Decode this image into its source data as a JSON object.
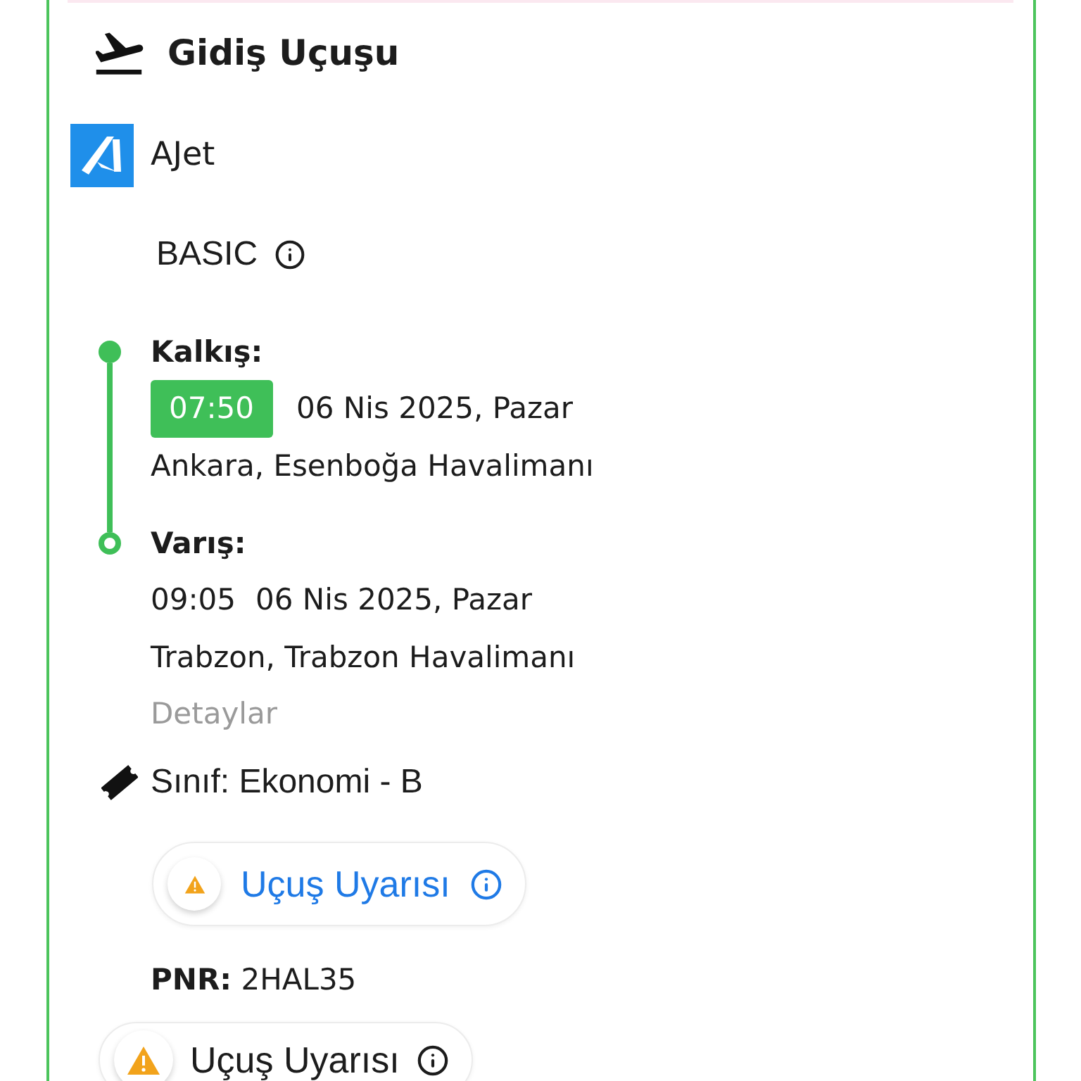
{
  "section": {
    "title": "Gidiş Uçuşu"
  },
  "airline": {
    "name": "AJet"
  },
  "fare": {
    "name": "BASIC"
  },
  "itinerary": [
    {
      "kind": "departure",
      "label": "Kalkış:",
      "time": "07:50",
      "highlighted": true,
      "date": "06 Nis 2025, Pazar",
      "airport": "Ankara, Esenboğa Havalimanı"
    },
    {
      "kind": "arrival",
      "label": "Varış:",
      "time": "09:05",
      "highlighted": false,
      "date": "06 Nis 2025, Pazar",
      "airport": "Trabzon, Trabzon Havalimanı"
    }
  ],
  "details_link": "Detaylar",
  "cabin_class": "Sınıf: Ekonomi - B",
  "flight_alert_button": {
    "label": "Uçuş Uyarısı"
  },
  "pnr": "**PNR:** 2HAL35",
  "flight_alert_banner": {
    "label": "Uçuş Uyarısı"
  }
}
